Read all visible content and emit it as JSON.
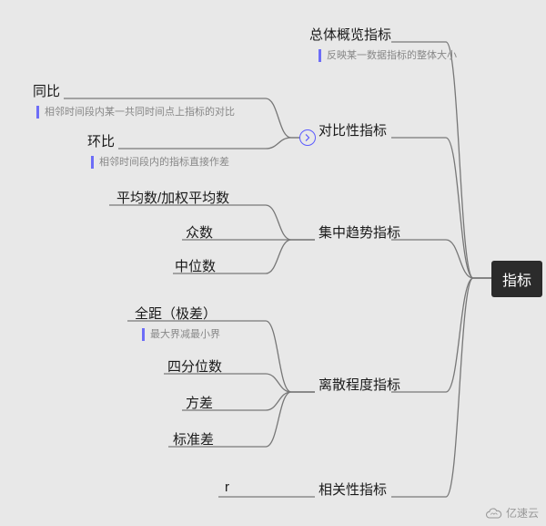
{
  "root": {
    "label": "指标"
  },
  "branches": {
    "overview": {
      "label": "总体概览指标",
      "note": "反映某一数据指标的整体大小"
    },
    "contrast": {
      "label": "对比性指标",
      "children": {
        "yoy": {
          "label": "同比",
          "note": "相邻时间段内某一共同时间点上指标的对比"
        },
        "mom": {
          "label": "环比",
          "note": "相邻时间段内的指标直接作差"
        }
      }
    },
    "central": {
      "label": "集中趋势指标",
      "children": {
        "mean": {
          "label": "平均数/加权平均数"
        },
        "mode": {
          "label": "众数"
        },
        "median": {
          "label": "中位数"
        }
      }
    },
    "dispersion": {
      "label": "离散程度指标",
      "children": {
        "range": {
          "label": "全距（极差）",
          "note": "最大界减最小界"
        },
        "quartile": {
          "label": "四分位数"
        },
        "variance": {
          "label": "方差"
        },
        "stddev": {
          "label": "标准差"
        }
      }
    },
    "correlation": {
      "label": "相关性指标",
      "children": {
        "r": {
          "label": "r"
        }
      }
    }
  },
  "watermark": {
    "text": "亿速云"
  }
}
